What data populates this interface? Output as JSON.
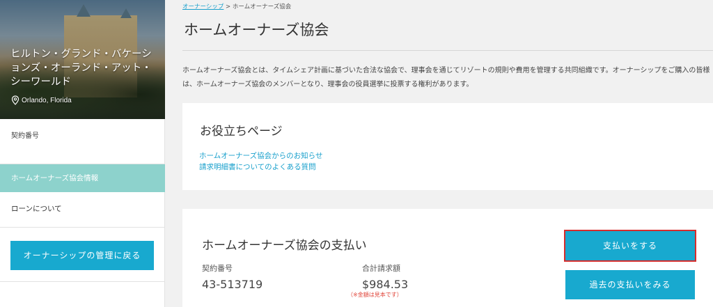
{
  "sidebar": {
    "resort_name": "ヒルトン・グランド・バケーションズ・オーランド・アット・シーワールド",
    "location": "Orlando, Florida",
    "contract_label": "契約番号",
    "active_item": "ホームオーナーズ協会情報",
    "loan_item": "ローンについて",
    "back_button": "オーナーシップの管理に戻る"
  },
  "breadcrumb": {
    "link": "オーナーシップ",
    "separator": ">",
    "current": "ホームオーナーズ協会"
  },
  "page_title": "ホームオーナーズ協会",
  "intro": "ホームオーナーズ協会とは、タイムシェア計画に基づいた合法な協会で、理事会を通じてリゾートの規則や費用を管理する共同組織です。オーナーシップをご購入の皆様は、ホームオーナーズ協会のメンバーとなり、理事会の役員選挙に投票する権利があります。",
  "useful_pages": {
    "title": "お役立ちページ",
    "links": [
      "ホームオーナーズ協会からのお知らせ",
      "請求明細書についてのよくある質問"
    ]
  },
  "payment": {
    "title": "ホームオーナーズ協会の支払い",
    "contract_label": "契約番号",
    "contract_number": "43-513719",
    "total_label": "合計請求額",
    "total_amount": "$984.53",
    "note": "（※金額は見本です）",
    "pay_button": "支払いをする",
    "history_button": "過去の支払いをみる"
  },
  "icons": {
    "location": "map-pin-icon"
  },
  "colors": {
    "accent": "#18a9cf",
    "active_nav": "#8dd2cc",
    "link": "#19a0cc",
    "highlight_border": "#d62c2c",
    "note": "#e0453a"
  }
}
